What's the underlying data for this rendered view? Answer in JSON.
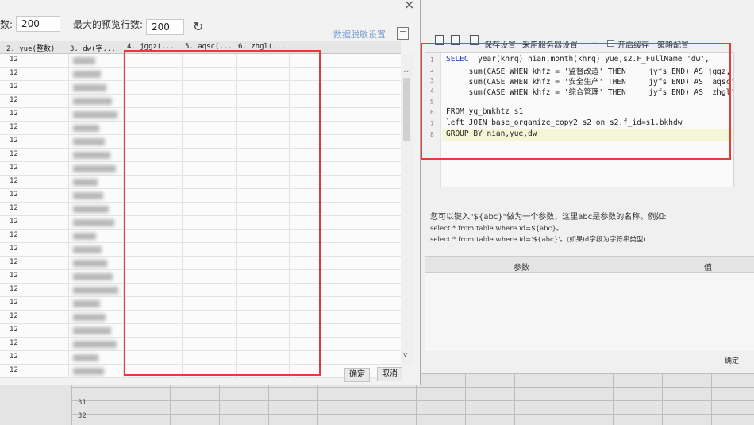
{
  "left_dialog": {
    "rows_label": "数:",
    "rows_value": "200",
    "max_preview_label": "最大的预览行数:",
    "max_preview_value": "200",
    "data_settings_link": "数据脱敏设置",
    "columns": [
      "2. yue(整数)",
      "3. dw(字...",
      "4. jggz(...",
      "5. aqsc(...",
      "6. zhgl(..."
    ],
    "row_value": "12",
    "ok_label": "确定",
    "cancel_label": "取消",
    "scroll_up": "^",
    "scroll_down": "v"
  },
  "right_panel": {
    "save_settings": "保存设置",
    "server_settings": "采用服务器设置",
    "enable_cache": "开启缓存",
    "strategy_config": "策略配置",
    "sql_lines": [
      "SELECT year(khrq) nian,month(khrq) yue,s2.F_FullName 'dw',",
      "     sum(CASE WHEN khfz = '监督改造' THEN     jyfs END) AS jggz,",
      "     sum(CASE WHEN khfz = '安全生产' THEN     jyfs END) AS 'aqsc',",
      "     sum(CASE WHEN khfz = '综合管理' THEN     jyfs END) AS 'zhgl'",
      "",
      "FROM yq_bmkhtz s1",
      "left JOIN base_organize_copy2 s2 on s2.f_id=s1.bkhdw",
      "GROUP BY nian,yue,dw"
    ],
    "line_numbers": [
      "1",
      "2",
      "3",
      "4",
      "5",
      "6",
      "7",
      "8"
    ],
    "help_line1": "您可以键入\"${abc}\"做为一个参数，这里abc是参数的名称。例如:",
    "help_line2": "select * from table where id=${abc}。",
    "help_line3": "select * from table where id='${abc}'。(如果id字段为字符串类型)",
    "param_col": "参数",
    "value_col": "值",
    "ok_label": "确定"
  },
  "sheet": {
    "row_numbers": [
      "31",
      "32"
    ]
  },
  "colors": {
    "annotation": "#e53b3b",
    "keyword": "#1a3bb5",
    "string": "#c8378e"
  }
}
